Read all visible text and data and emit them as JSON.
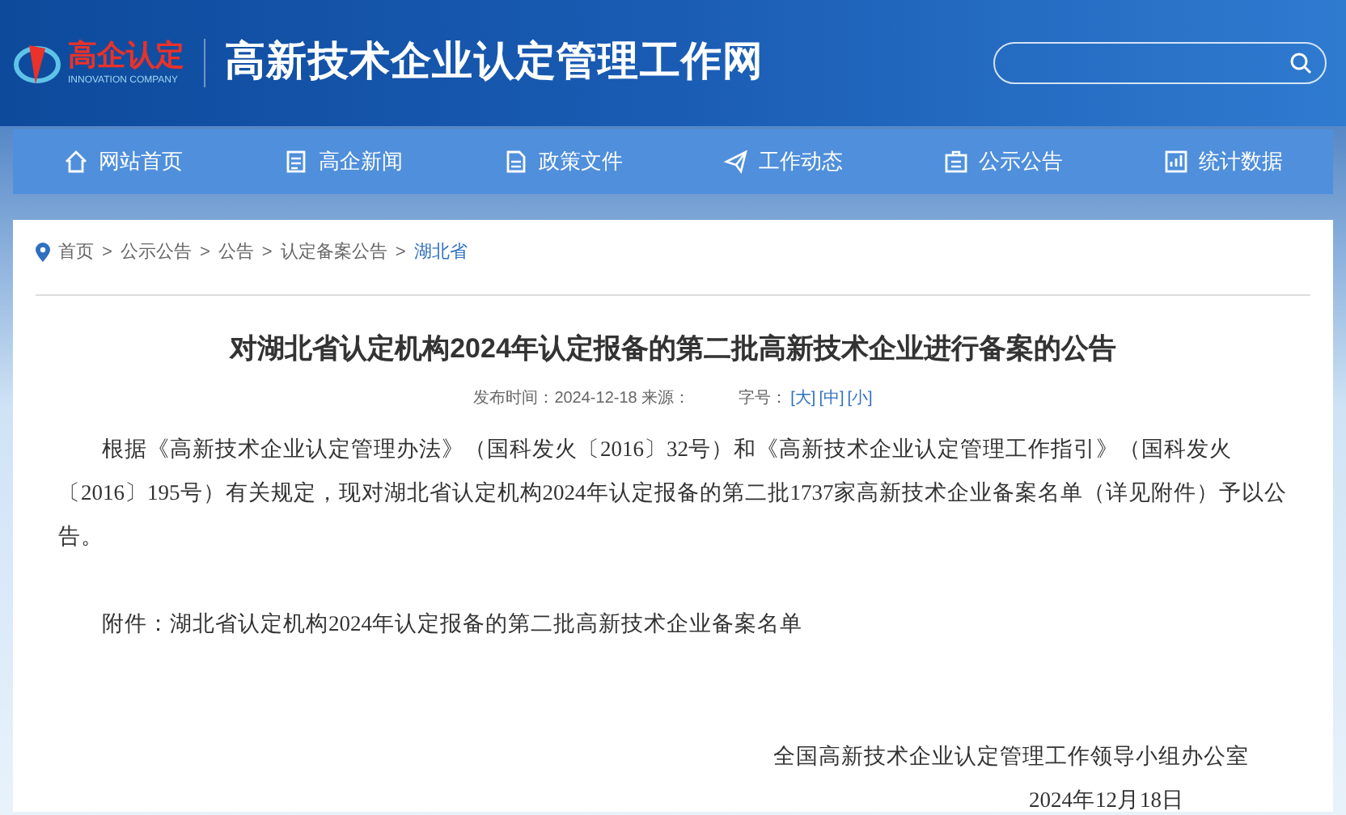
{
  "header": {
    "logo_text": "高企认定",
    "logo_subtext": "INNOVATION COMPANY",
    "site_title": "高新技术企业认定管理工作网"
  },
  "nav": [
    {
      "label": "网站首页"
    },
    {
      "label": "高企新闻"
    },
    {
      "label": "政策文件"
    },
    {
      "label": "工作动态"
    },
    {
      "label": "公示公告"
    },
    {
      "label": "统计数据"
    }
  ],
  "breadcrumb": {
    "separator": ">",
    "items": [
      {
        "label": "首页",
        "current": false
      },
      {
        "label": "公示公告",
        "current": false
      },
      {
        "label": "公告",
        "current": false
      },
      {
        "label": "认定备案公告",
        "current": false
      },
      {
        "label": "湖北省",
        "current": true
      }
    ]
  },
  "article": {
    "title": "对湖北省认定机构2024年认定报备的第二批高新技术企业进行备案的公告",
    "meta": "发布时间：2024-12-18 来源：",
    "font_size_label": "字号：",
    "font_sizes": [
      "[大]",
      "[中]",
      "[小]"
    ],
    "paragraphs": [
      "根据《高新技术企业认定管理办法》（国科发火〔2016〕32号）和《高新技术企业认定管理工作指引》（国科发火〔2016〕195号）有关规定，现对湖北省认定机构2024年认定报备的第二批1737家高新技术企业备案名单（详见附件）予以公告。",
      "附件：湖北省认定机构2024年认定报备的第二批高新技术企业备案名单"
    ],
    "signature": "全国高新技术企业认定管理工作领导小组办公室",
    "date": "2024年12月18日"
  }
}
